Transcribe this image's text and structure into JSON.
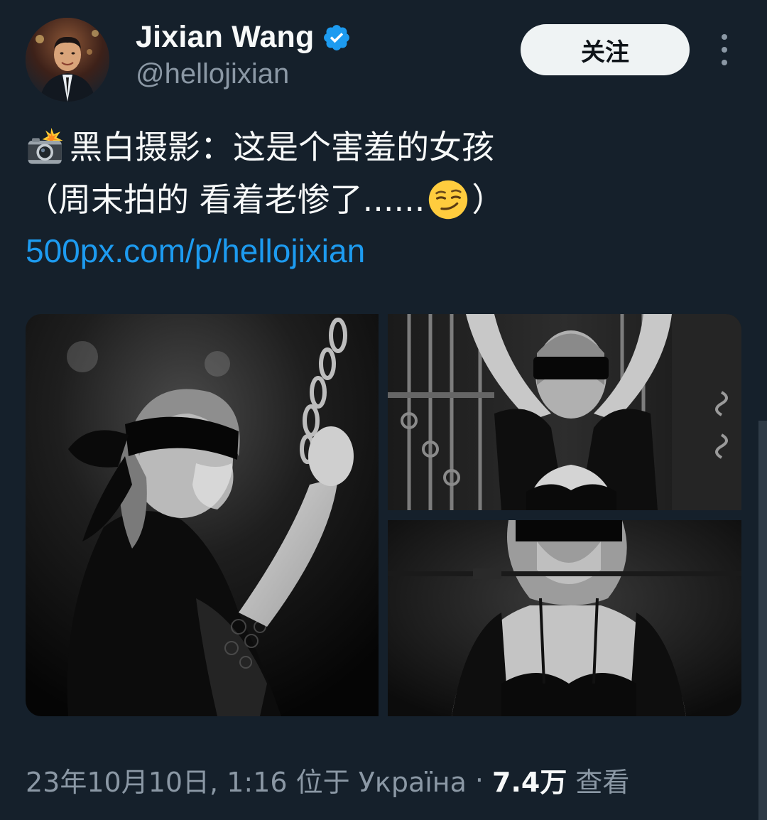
{
  "author": {
    "display_name": "Jixian Wang",
    "handle": "@hellojixian",
    "verified_icon": "verified-badge-icon"
  },
  "actions": {
    "follow_label": "关注",
    "more_icon": "more-vertical-icon"
  },
  "tweet": {
    "line1_emoji": "camera-flash-emoji",
    "line1_text": "黑白摄影：这是个害羞的女孩",
    "line2_text_before": "（周末拍的 看着老惨了......",
    "line2_emoji": "smirking-face-emoji",
    "line2_text_after": "）",
    "link_text": "500px.com/p/hellojixian"
  },
  "media": {
    "photos": [
      "photo-1",
      "photo-2",
      "photo-3"
    ]
  },
  "meta": {
    "timestamp": "23年10月10日, 1:16 位于 Україна",
    "separator": "·",
    "views_count": "7.4万",
    "views_label": "查看"
  },
  "colors": {
    "background": "#15202b",
    "text": "#f7f9f9",
    "secondary_text": "#8b98a5",
    "link": "#1d9bf0",
    "follow_button_bg": "#eff3f4"
  }
}
